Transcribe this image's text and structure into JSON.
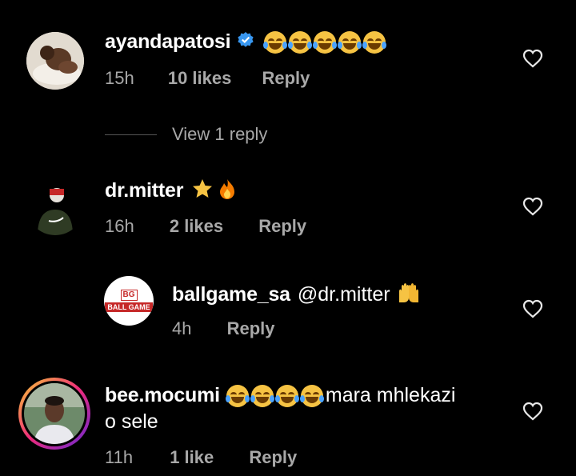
{
  "comments": [
    {
      "username": "ayandapatosi",
      "verified": true,
      "text": "",
      "emoji_count": 5,
      "time": "15h",
      "likes": "10 likes",
      "reply": "Reply",
      "view_replies": "View 1 reply"
    },
    {
      "username": "dr.mitter",
      "text": "",
      "emojis": [
        "star-emoji",
        "fire-emoji"
      ],
      "time": "16h",
      "likes": "2 likes",
      "reply": "Reply"
    },
    {
      "username": "ballgame_sa",
      "text": "@dr.mitter",
      "emojis": [
        "raised-hands-emoji"
      ],
      "avatar_text": "BALL GAME",
      "avatar_logo": "BG",
      "time": "4h",
      "reply": "Reply"
    },
    {
      "username": "bee.mocumi",
      "text_line1": "mara mhlekazi",
      "text_line2": "o sele",
      "emoji_count": 4,
      "time": "11h",
      "likes": "1 like",
      "reply": "Reply"
    }
  ],
  "colors": {
    "background": "#000000",
    "meta": "#a8a8a8",
    "verified": "#3897f0",
    "story_ring": "#d6249f"
  }
}
